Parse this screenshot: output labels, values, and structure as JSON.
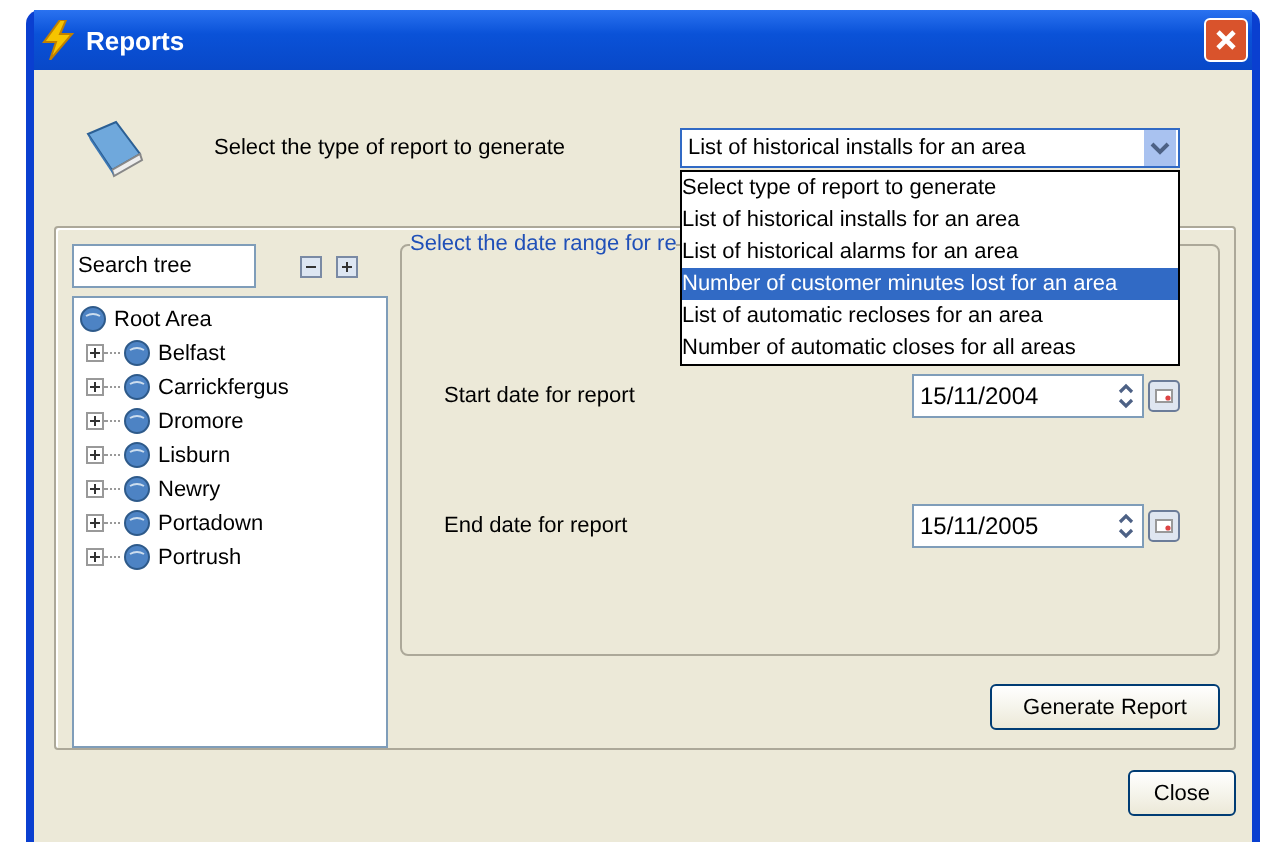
{
  "window": {
    "title": "Reports"
  },
  "report_type": {
    "label": "Select the type of report to generate",
    "value": "List of historical installs for an area",
    "expanded": true,
    "options": [
      {
        "label": "Select type of report to generate",
        "highlighted": false
      },
      {
        "label": "List of historical installs for an area",
        "highlighted": false
      },
      {
        "label": "List of historical alarms for an area",
        "highlighted": false
      },
      {
        "label": "Number of customer minutes lost for an area",
        "highlighted": true
      },
      {
        "label": "List of automatic recloses for an area",
        "highlighted": false
      },
      {
        "label": "Number of automatic closes for all areas",
        "highlighted": false
      }
    ]
  },
  "search": {
    "value": "Search tree"
  },
  "tree": [
    {
      "label": "Root Area",
      "children": [
        {
          "label": "Belfast"
        },
        {
          "label": "Carrickfergus"
        },
        {
          "label": "Dromore"
        },
        {
          "label": "Lisburn"
        },
        {
          "label": "Newry"
        },
        {
          "label": "Portadown"
        },
        {
          "label": "Portrush"
        }
      ]
    }
  ],
  "date_range": {
    "legend": "Select the date range for re",
    "start_label": "Start date for report",
    "start_value": "15/11/2004",
    "end_label": "End date for report",
    "end_value": "15/11/2005"
  },
  "buttons": {
    "generate": "Generate Report",
    "close": "Close"
  }
}
